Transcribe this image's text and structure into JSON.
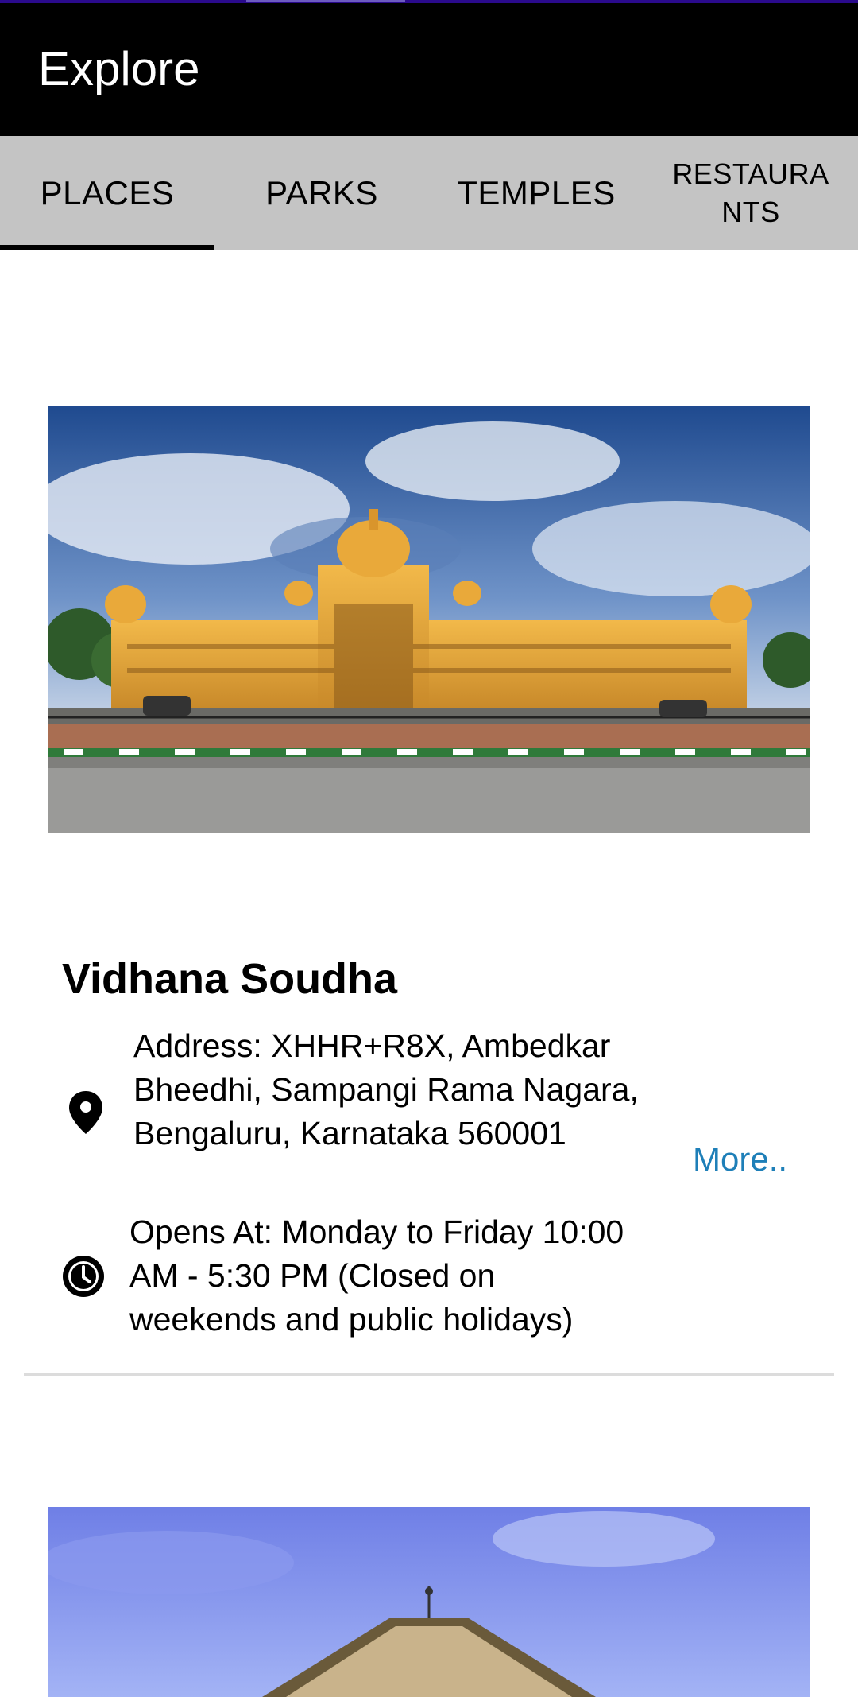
{
  "app_bar": {
    "title": "Explore"
  },
  "tabs": [
    {
      "label": "PLACES",
      "selected": true
    },
    {
      "label": "PARKS",
      "selected": false
    },
    {
      "label": "TEMPLES",
      "selected": false
    },
    {
      "label": "RESTAURANTS",
      "selected": false
    }
  ],
  "places": [
    {
      "name": "Vidhana Soudha",
      "address": "Address: XHHR+R8X, Ambedkar Bheedhi, Sampangi Rama Nagara, Bengaluru, Karnataka 560001",
      "hours": "Opens At: Monday to Friday 10:00 AM - 5:30 PM (Closed on weekends and public holidays)",
      "more_label": "More.."
    }
  ],
  "icons": {
    "address": "location-pin-icon",
    "hours": "clock-icon"
  },
  "colors": {
    "app_bar": "#000000",
    "tab_bar": "#c4c4c4",
    "link": "#1e7fb8",
    "top_accent": "#2a0a8c"
  }
}
